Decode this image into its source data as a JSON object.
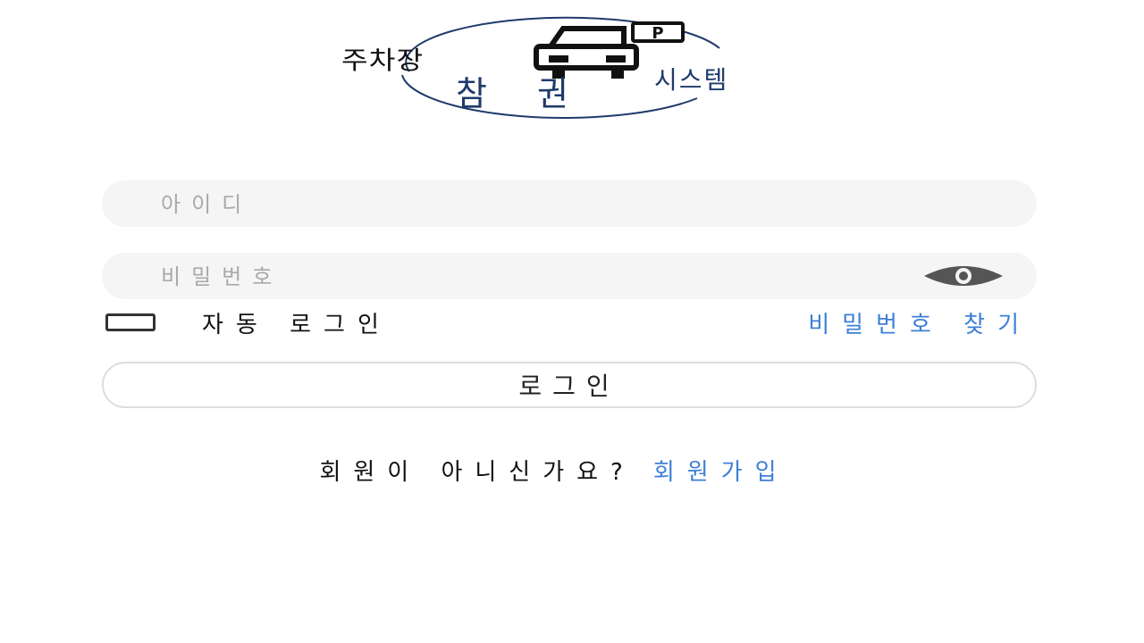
{
  "logo": {
    "top_text": "주차장",
    "main_text": "참 권",
    "sub_text": "시스템",
    "parking_sign": "P"
  },
  "login_form": {
    "id_placeholder": "아이디",
    "password_placeholder": "비밀번호",
    "auto_login_label": "자동 로그인",
    "find_password_label": "비밀번호 찾기",
    "login_button_label": "로그인"
  },
  "signup": {
    "question": "회원이 아니신가요?",
    "link_label": "회원가입"
  },
  "colors": {
    "link": "#3d7fd6",
    "field_bg": "#f5f5f5",
    "logo_blue": "#1f3a6b"
  }
}
